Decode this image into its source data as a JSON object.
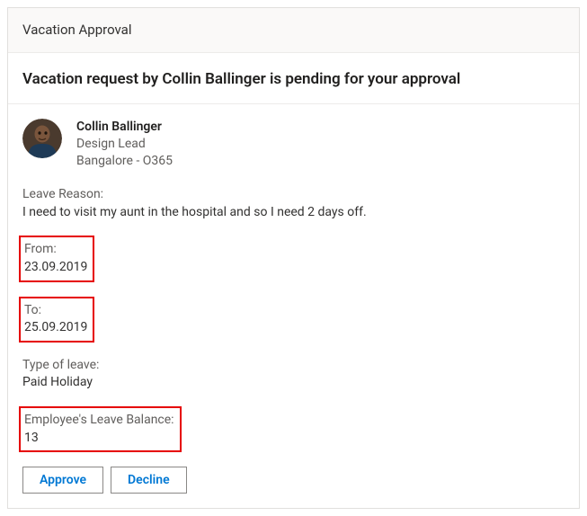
{
  "header": {
    "title": "Vacation Approval"
  },
  "body": {
    "title": "Vacation request by Collin Ballinger is pending for your approval"
  },
  "requester": {
    "name": "Collin Ballinger",
    "role": "Design Lead",
    "location": "Bangalore - O365"
  },
  "reason": {
    "label": "Leave Reason:",
    "value": "I need to visit my aunt in the hospital and so I need 2 days off."
  },
  "from": {
    "label": "From:",
    "value": "23.09.2019"
  },
  "to": {
    "label": "To:",
    "value": "25.09.2019"
  },
  "type": {
    "label": "Type of leave:",
    "value": "Paid Holiday"
  },
  "balance": {
    "label": "Employee's Leave Balance:",
    "value": "13"
  },
  "actions": {
    "approve": "Approve",
    "decline": "Decline"
  }
}
